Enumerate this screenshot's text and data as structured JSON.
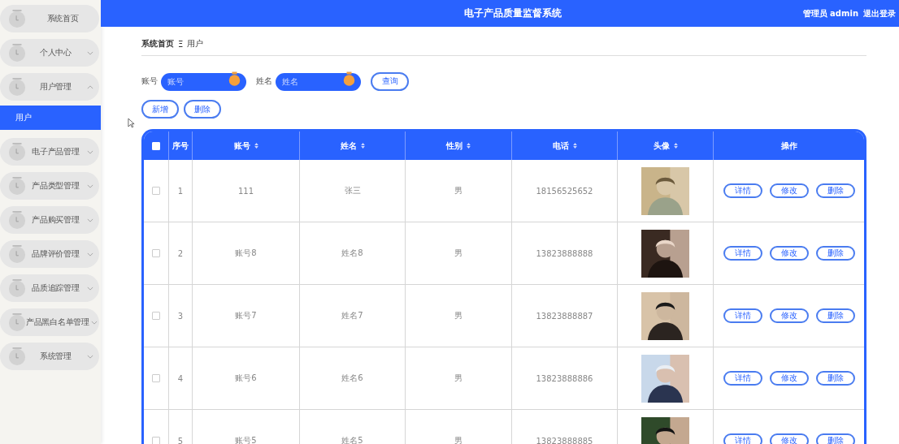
{
  "sidebar": {
    "items": [
      {
        "label": "系统首页"
      },
      {
        "label": "个人中心",
        "expanded": false
      },
      {
        "label": "用户管理",
        "expanded": true,
        "children": [
          {
            "label": "用户",
            "selected": true
          }
        ]
      },
      {
        "label": "电子产品管理",
        "expanded": false
      },
      {
        "label": "产品类型管理",
        "expanded": false
      },
      {
        "label": "产品购买管理",
        "expanded": false
      },
      {
        "label": "品牌评价管理",
        "expanded": false
      },
      {
        "label": "品质追踪管理",
        "expanded": false
      },
      {
        "label": "产品黑白名单管理",
        "expanded": false
      },
      {
        "label": "系统管理",
        "expanded": false
      }
    ]
  },
  "header": {
    "title": "电子产品质量监督系统",
    "user": "管理员 admin",
    "logout": "退出登录"
  },
  "breadcrumb": {
    "items": [
      "系统首页",
      "用户"
    ],
    "separator": "Ξ"
  },
  "search": {
    "fields": [
      {
        "label": "账号",
        "placeholder": "账号"
      },
      {
        "label": "姓名",
        "placeholder": "姓名"
      }
    ],
    "button": "查询"
  },
  "actions": [
    "新增",
    "删除"
  ],
  "table": {
    "columns": [
      {
        "label": "序号",
        "sortable": false
      },
      {
        "label": "账号",
        "sortable": true
      },
      {
        "label": "姓名",
        "sortable": true
      },
      {
        "label": "性别",
        "sortable": true
      },
      {
        "label": "电话",
        "sortable": true
      },
      {
        "label": "头像",
        "sortable": true
      },
      {
        "label": "操作",
        "sortable": false
      }
    ],
    "header_checked": false,
    "rows": [
      {
        "index": "1",
        "account": "111",
        "name": "张三",
        "gender": "男",
        "phone": "18156525652",
        "checked": false,
        "actions": [
          "详情",
          "修改",
          "删除"
        ]
      },
      {
        "index": "2",
        "account": "账号8",
        "name": "姓名8",
        "gender": "男",
        "phone": "13823888888",
        "checked": false,
        "actions": [
          "详情",
          "修改",
          "删除"
        ]
      },
      {
        "index": "3",
        "account": "账号7",
        "name": "姓名7",
        "gender": "男",
        "phone": "13823888887",
        "checked": false,
        "actions": [
          "详情",
          "修改",
          "删除"
        ]
      },
      {
        "index": "4",
        "account": "账号6",
        "name": "姓名6",
        "gender": "男",
        "phone": "13823888886",
        "checked": false,
        "actions": [
          "详情",
          "修改",
          "删除"
        ]
      },
      {
        "index": "5",
        "account": "账号5",
        "name": "姓名5",
        "gender": "男",
        "phone": "13823888885",
        "checked": false,
        "actions": [
          "详情",
          "修改",
          "删除"
        ]
      }
    ]
  }
}
